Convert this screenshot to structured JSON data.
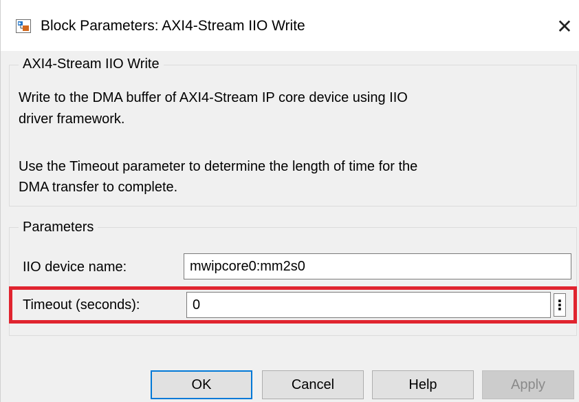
{
  "window": {
    "title": "Block Parameters: AXI4-Stream IIO Write",
    "close_glyph": "✕"
  },
  "description_group": {
    "legend": "AXI4-Stream IIO Write",
    "lines": [
      "Write to the DMA buffer of AXI4-Stream IP core device using IIO",
      "driver framework.",
      "Use the Timeout parameter to determine the length of time for the",
      "DMA transfer to complete."
    ]
  },
  "parameters_group": {
    "legend": "Parameters",
    "device_name": {
      "label": "IIO device name:",
      "value": "mwipcore0:mm2s0"
    },
    "timeout": {
      "label": "Timeout (seconds):",
      "value": "0",
      "more_glyph": "⋮",
      "highlighted": true,
      "highlight_color": "#e0242f"
    }
  },
  "buttons": {
    "ok": "OK",
    "cancel": "Cancel",
    "help": "Help",
    "apply": "Apply"
  },
  "colors": {
    "dialog_background": "#f0f0f0",
    "titlebar_background": "#ffffff",
    "default_button_border": "#0078d7",
    "disabled_text": "#8a8a8a"
  },
  "icons": {
    "app_icon": "simulink-block-icon",
    "close_icon": "close-icon",
    "more_icon": "vertical-ellipsis-icon"
  }
}
